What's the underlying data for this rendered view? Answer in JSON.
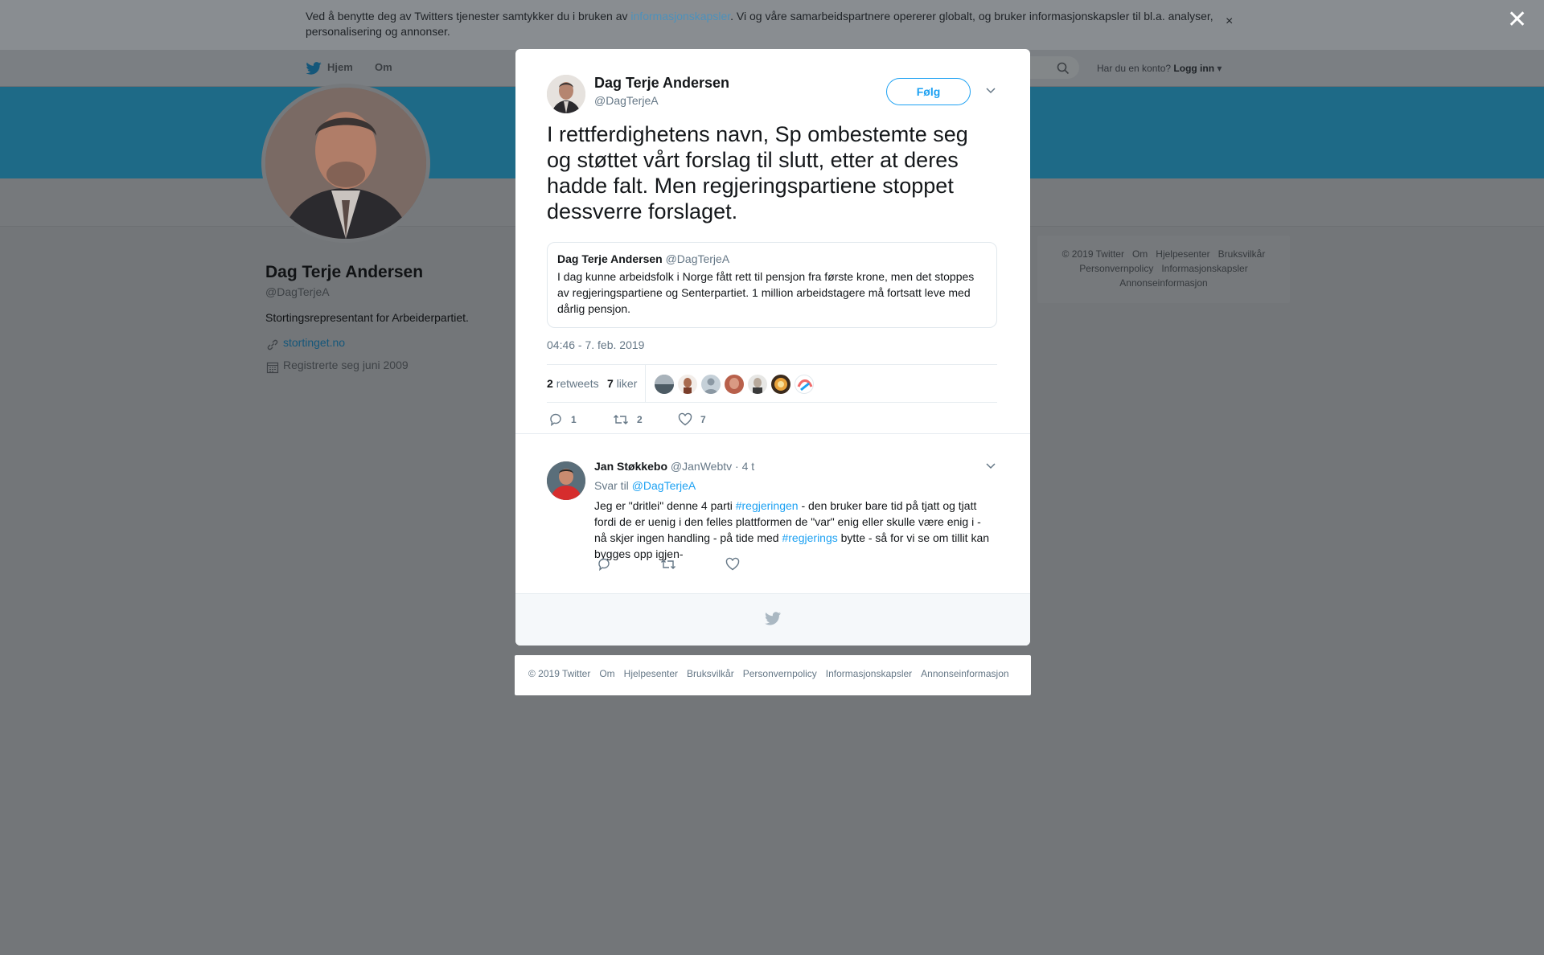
{
  "cookie_banner": {
    "text_before": "Ved å benytte deg av Twitters tjenester samtykker du i bruken av ",
    "link": "informasjonskapsler",
    "text_after": ". Vi og våre samarbeidspartnere opererer globalt, og bruker informasjonskapsler til bl.a. analyser, personalisering og annonser.",
    "close": "×"
  },
  "nav": {
    "home": "Hjem",
    "about": "Om",
    "login_question": "Har du en konto?",
    "login": "Logg inn"
  },
  "profile": {
    "name": "Dag Terje Andersen",
    "handle": "@DagTerjeA",
    "bio": "Stortingsrepresentant for Arbeiderpartiet.",
    "website": "stortinget.no",
    "joined": "Registrerte seg juni 2009"
  },
  "side_footer": [
    "© 2019 Twitter",
    "Om",
    "Hjelpesenter",
    "Bruksvilkår",
    "Personvernpolicy",
    "Informasjonskapsler",
    "Annonseinformasjon"
  ],
  "tweet": {
    "name": "Dag Terje Andersen",
    "handle": "@DagTerjeA",
    "follow_label": "Følg",
    "text": "I rettferdighetens navn, Sp ombestemte seg og støttet vårt forslag til slutt, etter at deres hadde falt. Men regjeringspartiene stoppet dessverre forslaget.",
    "quoted": {
      "name": "Dag Terje Andersen",
      "handle": "@DagTerjeA",
      "text": "I dag kunne arbeidsfolk i Norge fått rett til pensjon fra første krone, men det stoppes av regjeringspartiene og Senterpartiet. 1 million arbeidstagere må fortsatt leve med dårlig pensjon."
    },
    "timestamp": "04:46 - 7. feb. 2019",
    "retweet_count": "2",
    "retweet_label": "retweets",
    "like_count": "7",
    "like_label": "liker",
    "actions": {
      "replies": "1",
      "retweets": "2",
      "likes": "7"
    }
  },
  "reply": {
    "name": "Jan Støkkebo",
    "handle": "@JanWebtv",
    "time": "· 4 t",
    "reply_to_label": "Svar til",
    "reply_to": "@DagTerjeA",
    "text_1": "Jeg er \"dritlei\" denne 4 parti ",
    "hashtag_1": "#regjeringen",
    "text_2": " - den bruker bare tid på tjatt og tjatt fordi de er uenig i den felles plattformen de \"var\" enig eller skulle være enig i - nå skjer ingen handling - på tide med ",
    "hashtag_2": "#regjerings",
    "text_3": " bytte - så for vi se om tillit kan bygges opp igjen-"
  },
  "footer": [
    "© 2019 Twitter",
    "Om",
    "Hjelpesenter",
    "Bruksvilkår",
    "Personvernpolicy",
    "Informasjonskapsler",
    "Annonseinformasjon"
  ],
  "colors": {
    "accent": "#1da1f2",
    "overlay": "#737679",
    "banner": "#1e6a87"
  }
}
